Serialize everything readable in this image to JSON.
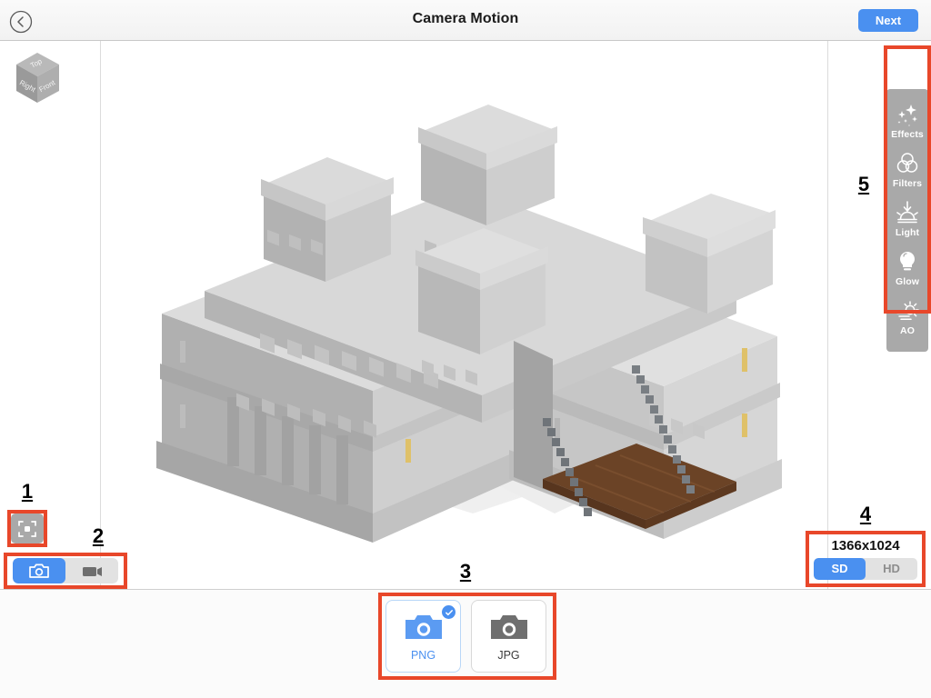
{
  "window": {
    "title": "Camera Motion"
  },
  "topbar": {
    "back_icon": "chevron-left-circle-icon",
    "title": "Camera Motion",
    "next_label": "Next"
  },
  "viewport": {
    "gizmo": {
      "name": "view-orientation-cube",
      "faces": [
        "Top",
        "Right",
        "Front"
      ]
    },
    "model": {
      "name": "voxel-castle-model",
      "description": "gray voxel castle with crenellated towers, brown wooden drawbridge and chains"
    }
  },
  "effects_sidebar": {
    "annotation": "5",
    "items": [
      {
        "label": "Effects",
        "icon": "sparkles-icon"
      },
      {
        "label": "Filters",
        "icon": "overlapping-circles-icon"
      },
      {
        "label": "Light",
        "icon": "light-down-arrow-icon"
      },
      {
        "label": "Glow",
        "icon": "lightbulb-icon"
      },
      {
        "label": "AO",
        "icon": "ambient-occlusion-sun-icon"
      }
    ]
  },
  "fit_control": {
    "annotation": "1",
    "icon": "fit-to-frame-icon",
    "tooltip": "Fit to frame"
  },
  "capture_mode": {
    "annotation": "2",
    "options": [
      {
        "icon": "photo-camera-icon",
        "selected": true
      },
      {
        "icon": "video-camera-icon",
        "selected": false
      }
    ]
  },
  "export_format": {
    "annotation": "3",
    "options": [
      {
        "label": "PNG",
        "icon": "photo-camera-icon",
        "selected": true,
        "badge": "check-icon"
      },
      {
        "label": "JPG",
        "icon": "photo-camera-icon",
        "selected": false,
        "badge": ""
      }
    ]
  },
  "resolution": {
    "annotation": "4",
    "size_label": "1366x1024",
    "quality_options": [
      {
        "label": "SD",
        "selected": true
      },
      {
        "label": "HD",
        "selected": false
      }
    ]
  },
  "colors": {
    "accent_blue": "#4a90f0",
    "annotation_red": "#e8472a",
    "panel_gray": "#a9a9a9",
    "segment_gray": "#e2e2e2",
    "wood_brown": "#6b4326"
  }
}
